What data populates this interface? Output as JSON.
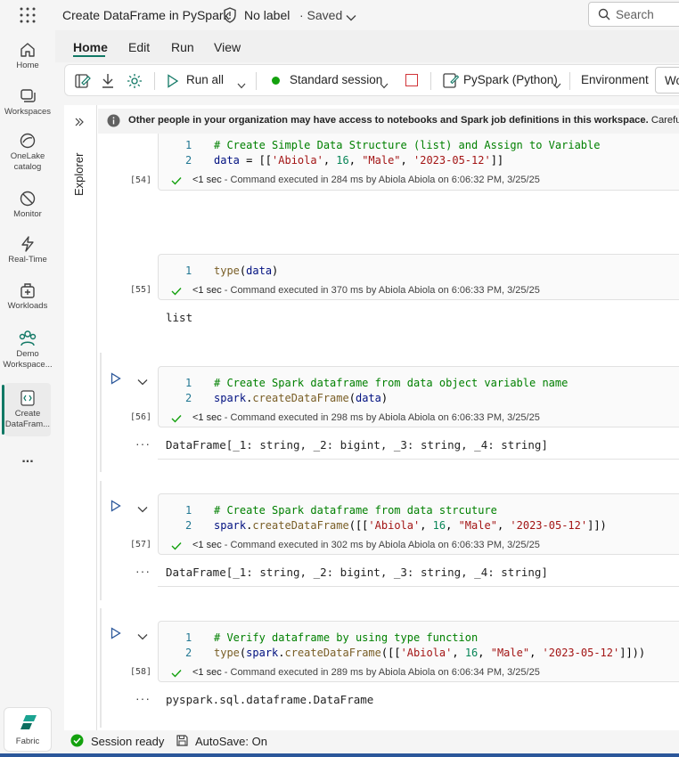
{
  "topbar": {
    "apps_icon": "waffle-icon",
    "title": "Create DataFrame in PySpark",
    "label": "No label",
    "saved": "· Saved",
    "search_placeholder": "Search"
  },
  "leftnav": {
    "items": [
      {
        "label": "Home",
        "icon": "home-icon"
      },
      {
        "label": "Workspaces",
        "icon": "workspaces-icon"
      },
      {
        "label": "OneLake catalog",
        "icon": "onelake-icon"
      },
      {
        "label": "Monitor",
        "icon": "monitor-icon"
      },
      {
        "label": "Real-Time",
        "icon": "realtime-icon"
      },
      {
        "label": "Workloads",
        "icon": "workloads-icon"
      },
      {
        "label": "Demo Workspace...",
        "icon": "demo-workspace-icon"
      },
      {
        "label": "Create DataFram...",
        "icon": "notebook-icon"
      }
    ],
    "more": "...",
    "fabric_label": "Fabric"
  },
  "ribbon": {
    "tabs": [
      "Home",
      "Edit",
      "Run",
      "View"
    ],
    "run_all": "Run all",
    "session": "Standard session",
    "language": "PySpark (Python)",
    "environment": "Environment",
    "workspace_short": "Wo"
  },
  "infobar": {
    "bold": "Other people in your organization may have access to notebooks and Spark job definitions in this workspace.",
    "rest": " Carefully re"
  },
  "explorer": {
    "label": "Explorer"
  },
  "cells": [
    {
      "exec": "[54]",
      "lines": [
        "# Create Simple Data Structure (list) and Assign to Variable",
        "data = [['Abiola', 16, \"Male\", '2023-05-12']]"
      ],
      "status_time": "<1 sec",
      "status_rest": " - Command executed in 284 ms by Abiola Abiola on 6:06:32 PM, 3/25/25"
    },
    {
      "exec": "[55]",
      "lines": [
        "type(data)"
      ],
      "status_time": "<1 sec",
      "status_rest": " - Command executed in 370 ms by Abiola Abiola on 6:06:33 PM, 3/25/25",
      "output": "list"
    },
    {
      "exec": "[56]",
      "lines": [
        "# Create Spark dataframe from data object variable name",
        "spark.createDataFrame(data)"
      ],
      "status_time": "<1 sec",
      "status_rest": " - Command executed in 298 ms by Abiola Abiola on 6:06:33 PM, 3/25/25",
      "output": "DataFrame[_1: string, _2: bigint, _3: string, _4: string]"
    },
    {
      "exec": "[57]",
      "lines": [
        "# Create Spark dataframe from data strcuture",
        "spark.createDataFrame([['Abiola', 16, \"Male\", '2023-05-12']])"
      ],
      "status_time": "<1 sec",
      "status_rest": " - Command executed in 302 ms by Abiola Abiola on 6:06:33 PM, 3/25/25",
      "output": "DataFrame[_1: string, _2: bigint, _3: string, _4: string]"
    },
    {
      "exec": "[58]",
      "lines": [
        "# Verify dataframe by using type function",
        "type(spark.createDataFrame([['Abiola', 16, \"Male\", '2023-05-12']]))"
      ],
      "status_time": "<1 sec",
      "status_rest": " - Command executed in 289 ms by Abiola Abiola on 6:06:34 PM, 3/25/25",
      "output": "pyspark.sql.dataframe.DataFrame"
    }
  ],
  "line_numbers": [
    "1",
    "2"
  ],
  "more_dots": "···",
  "statusbar": {
    "session": "Session ready",
    "autosave": "AutoSave: On"
  },
  "colors": {
    "accent": "#117865",
    "session_dot": "#13a10e",
    "stop_red": "#d13438"
  }
}
